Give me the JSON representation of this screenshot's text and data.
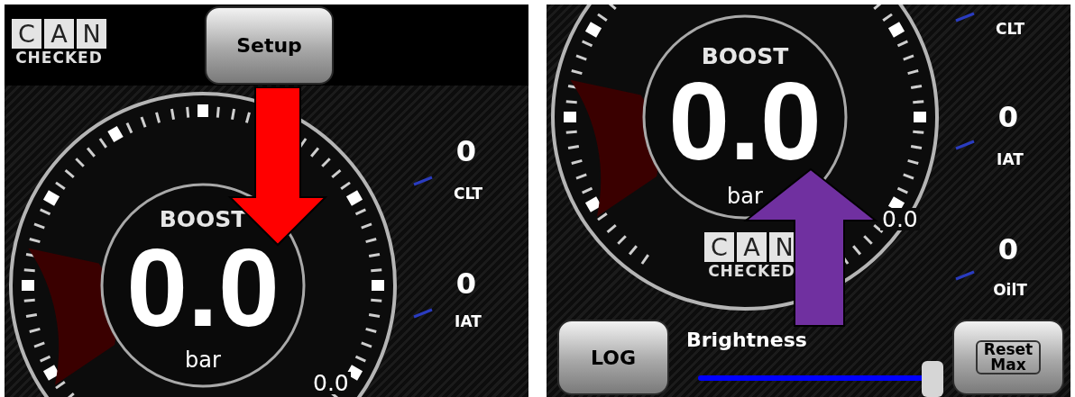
{
  "panels": [
    {
      "kind": "top",
      "logo": {
        "letters": [
          "C",
          "A",
          "N"
        ],
        "subtitle": "CHECKED"
      },
      "buttons": [
        {
          "kind": "setup",
          "label": "Setup"
        }
      ],
      "gauge": {
        "title": "BOOST",
        "value": "0.0",
        "unit": "bar",
        "reading": "0.0"
      },
      "side": [
        {
          "value": "0",
          "label": "CLT"
        },
        {
          "value": "0",
          "label": "IAT"
        }
      ],
      "arrow": {
        "kind": "down",
        "color": "#ff0000"
      }
    },
    {
      "kind": "bottom",
      "logo": {
        "letters": [
          "C",
          "A",
          "N"
        ],
        "subtitle": "CHECKED"
      },
      "buttons": [
        {
          "kind": "log",
          "label": "LOG"
        },
        {
          "kind": "reset",
          "label": "Reset Max"
        }
      ],
      "slider": {
        "label": "Brightness",
        "level": 0.95
      },
      "gauge": {
        "title": "BOOST",
        "value": "0.0",
        "unit": "bar",
        "reading": "0.0"
      },
      "side": [
        {
          "label": "CLT"
        },
        {
          "value": "0",
          "label": "IAT"
        },
        {
          "value": "0",
          "label": "OilT"
        }
      ],
      "arrow": {
        "kind": "up",
        "color": "#7030a0"
      }
    }
  ]
}
